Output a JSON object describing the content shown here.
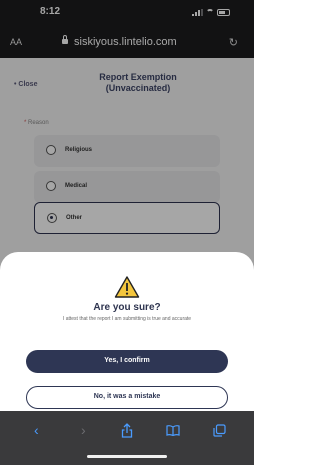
{
  "status": {
    "time": "8:12"
  },
  "browser": {
    "aa_label": "AA",
    "url": "siskiyous.lintelio.com"
  },
  "page": {
    "close_label": "• Close",
    "title": "Report Exemption (Unvaccinated)",
    "reason_label": "Reason",
    "options": [
      {
        "label": "Religious",
        "selected": false
      },
      {
        "label": "Medical",
        "selected": false
      },
      {
        "label": "Other",
        "selected": true
      }
    ]
  },
  "modal": {
    "icon": "warning-icon",
    "title": "Are you sure?",
    "description": "I attest that the report I am submitting is true and accurate",
    "confirm_label": "Yes, I confirm",
    "cancel_label": "No, it was a mistake"
  },
  "toolbar": {
    "icons": [
      "back-icon",
      "forward-icon",
      "share-icon",
      "bookmarks-icon",
      "tabs-icon"
    ]
  },
  "colors": {
    "primary": "#2e3654",
    "warning": "#f4c63d",
    "safari_link": "#4a9cff"
  }
}
